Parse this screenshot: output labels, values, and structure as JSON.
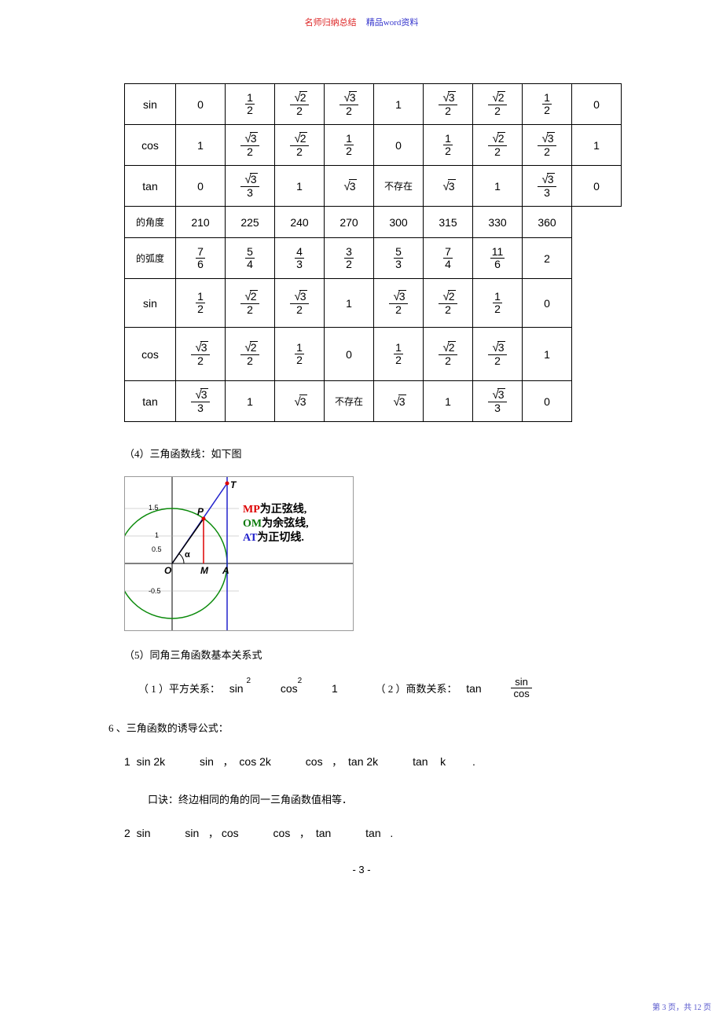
{
  "header": {
    "left": "名师归纳总结",
    "right": "精品word资料"
  },
  "table1": {
    "rows": [
      {
        "h": "sin",
        "cells": [
          "0",
          "1/2",
          "√2/2",
          "√3/2",
          "1",
          "√3/2",
          "√2/2",
          "1/2",
          "0"
        ]
      },
      {
        "h": "cos",
        "cells": [
          "1",
          "√3/2",
          "√2/2",
          "1/2",
          "0",
          "1/2",
          "√2/2",
          "√3/2",
          "1"
        ]
      },
      {
        "h": "tan",
        "cells": [
          "0",
          "√3/3",
          "1",
          "√3",
          "不存在",
          "√3",
          "1",
          "√3/3",
          "0"
        ]
      }
    ]
  },
  "table2": {
    "rows": [
      {
        "h": "的角度",
        "cells": [
          "210",
          "225",
          "240",
          "270",
          "300",
          "315",
          "330",
          "360"
        ]
      },
      {
        "h": "的弧度",
        "cells": [
          "7/6",
          "5/4",
          "4/3",
          "3/2",
          "5/3",
          "7/4",
          "11/6",
          "2"
        ]
      },
      {
        "h": "sin",
        "cells": [
          "1/2",
          "√2/2",
          "√3/2",
          "1",
          "√3/2",
          "√2/2",
          "1/2",
          "0"
        ]
      },
      {
        "h": "cos",
        "cells": [
          "√3/2",
          "√2/2",
          "1/2",
          "0",
          "1/2",
          "√2/2",
          "√3/2",
          "1"
        ]
      },
      {
        "h": "tan",
        "cells": [
          "√3/3",
          "1",
          "√3",
          "不存在",
          "√3",
          "1",
          "√3/3",
          "0"
        ]
      }
    ]
  },
  "sections": {
    "s4": "（4）三角函数线：如下图",
    "fig": {
      "mp": "MP为正弦线,",
      "om": "OM为余弦线,",
      "at": "AT为正切线.",
      "labels": {
        "T": "T",
        "P": "P",
        "O": "O",
        "M": "M",
        "A": "A",
        "alpha": "α"
      }
    },
    "s5": "（5）同角三角函数基本关系式",
    "rel1_label": "（ 1 ）平方关系：",
    "rel1_formula_parts": {
      "a": "sin",
      "b": "2",
      "c": "cos",
      "d": "2",
      "e": "1"
    },
    "rel2_label": "（ 2 ）商数关系：",
    "rel2_tan": "tan",
    "rel2_sin": "sin",
    "rel2_cos": "cos",
    "s6": "6 、三角函数的诱导公式：",
    "f1": {
      "lead": "1",
      "parts": [
        "sin  2k",
        "sin",
        "，",
        "cos 2k",
        "cos",
        "，",
        "tan 2k",
        "tan",
        "k",
        "."
      ]
    },
    "koujue1": "口诀：终边相同的角的同一三角函数值相等．",
    "f2": {
      "lead": "2",
      "parts": [
        "sin",
        "sin",
        "，",
        "cos",
        "cos",
        "，",
        "tan",
        "tan",
        "."
      ]
    }
  },
  "pagenum": "- 3 -",
  "footer": "第 3 页，共 12 页",
  "chart_data": {
    "type": "table",
    "title": "特殊角三角函数值表",
    "tables": [
      {
        "functions": [
          "sin",
          "cos",
          "tan"
        ],
        "sin": [
          "0",
          "1/2",
          "√2/2",
          "√3/2",
          "1",
          "√3/2",
          "√2/2",
          "1/2",
          "0"
        ],
        "cos": [
          "1",
          "√3/2",
          "√2/2",
          "1/2",
          "0",
          "1/2",
          "√2/2",
          "√3/2",
          "1"
        ],
        "tan": [
          "0",
          "√3/3",
          "1",
          "√3",
          "不存在",
          "√3",
          "1",
          "√3/3",
          "0"
        ]
      },
      {
        "angle_deg": [
          210,
          225,
          240,
          270,
          300,
          315,
          330,
          360
        ],
        "angle_rad": [
          "7π/6",
          "5π/4",
          "4π/3",
          "3π/2",
          "5π/3",
          "7π/4",
          "11π/6",
          "2π"
        ],
        "sin": [
          "1/2",
          "√2/2",
          "√3/2",
          "1",
          "√3/2",
          "√2/2",
          "1/2",
          "0"
        ],
        "cos": [
          "√3/2",
          "√2/2",
          "1/2",
          "0",
          "1/2",
          "√2/2",
          "√3/2",
          "1"
        ],
        "tan": [
          "√3/3",
          "1",
          "√3",
          "不存在",
          "√3",
          "1",
          "√3/3",
          "0"
        ]
      }
    ]
  }
}
